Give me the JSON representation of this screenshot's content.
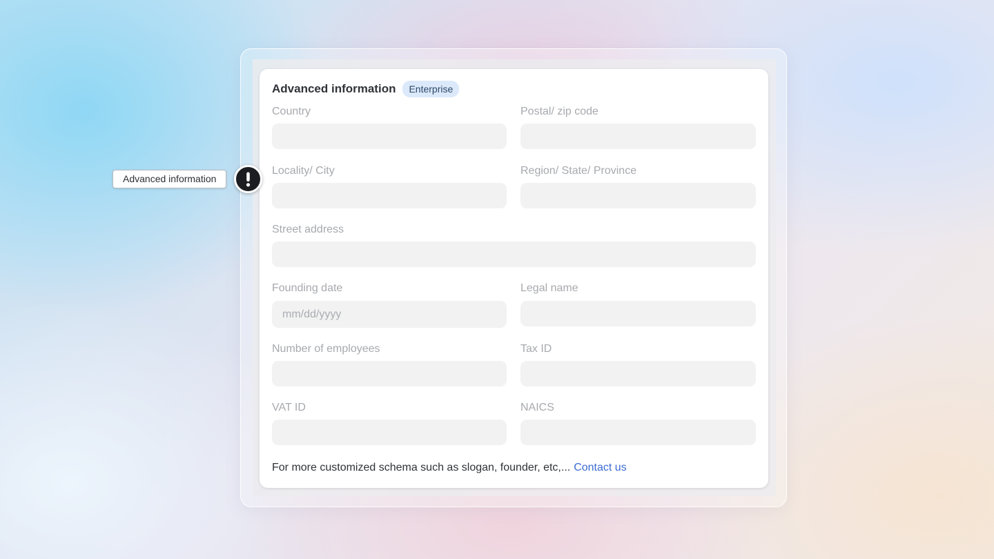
{
  "callout": {
    "label": "Advanced information",
    "icon": "exclamation-icon"
  },
  "card": {
    "title": "Advanced information",
    "badge": "Enterprise",
    "badge_color": "#dbe9fb",
    "fields": {
      "country": {
        "label": "Country",
        "value": ""
      },
      "postal": {
        "label": "Postal/ zip code",
        "value": ""
      },
      "locality": {
        "label": "Locality/ City",
        "value": ""
      },
      "region": {
        "label": "Region/ State/ Province",
        "value": ""
      },
      "street": {
        "label": "Street address",
        "value": ""
      },
      "founding": {
        "label": "Founding date",
        "placeholder": "mm/dd/yyyy"
      },
      "legal": {
        "label": "Legal name",
        "value": ""
      },
      "employees": {
        "label": "Number of employees",
        "value": ""
      },
      "tax": {
        "label": "Tax ID",
        "value": ""
      },
      "vat": {
        "label": "VAT ID",
        "value": ""
      },
      "naics": {
        "label": "NAICS",
        "value": ""
      }
    },
    "footer": {
      "text": "For more customized schema such as slogan, founder, etc,...",
      "link": "Contact us",
      "link_color": "#3b6cd3"
    }
  }
}
